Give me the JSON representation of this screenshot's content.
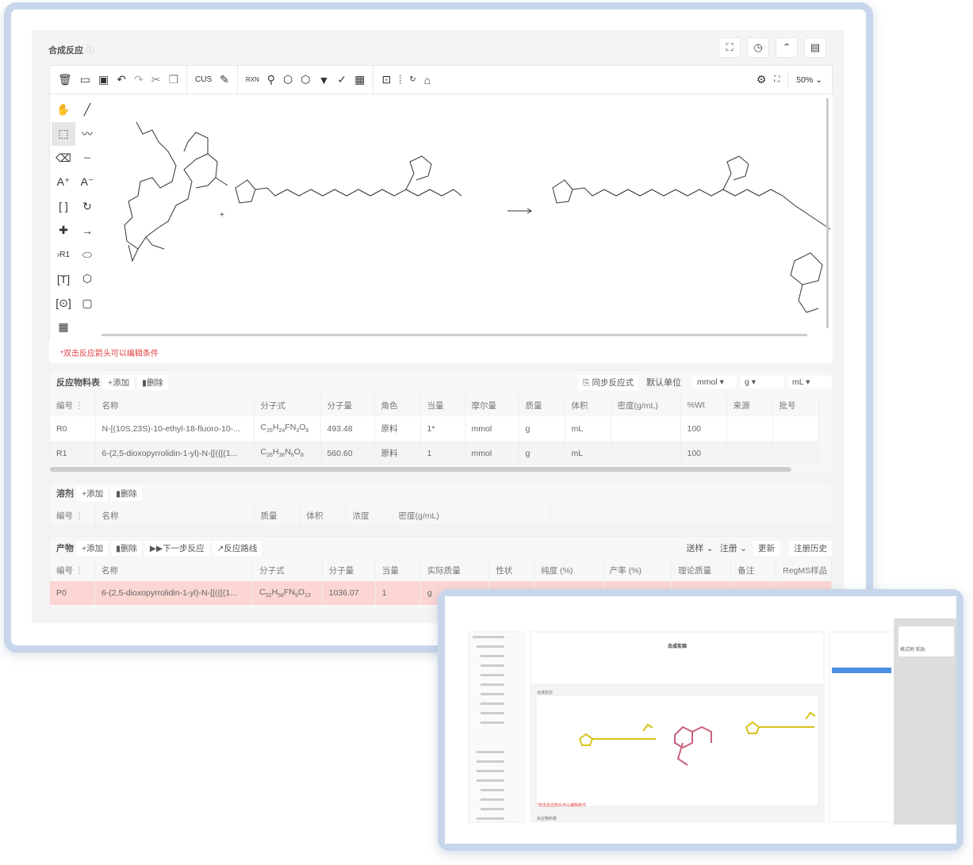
{
  "section": {
    "title": "合成反应",
    "help_icon": "question-circle-icon",
    "header_icons": [
      "fullscreen-icon",
      "history-icon",
      "collapse-icon",
      "notes-icon"
    ]
  },
  "toolbar": {
    "cus": "CUS",
    "zoom": "50%",
    "rxn": "RXN"
  },
  "note": "*双击反应箭头可以编辑条件",
  "reactants": {
    "title": "反应物料表",
    "add": "+添加",
    "delete": "删除",
    "sync": "同步反应式",
    "default_unit": "默认单位",
    "units": [
      "mmol",
      "g",
      "mL"
    ],
    "headers": [
      "编号",
      "名称",
      "分子式",
      "分子量",
      "角色",
      "当量",
      "摩尔量",
      "质量",
      "体积",
      "密度(g/mL)",
      "%Wt",
      "来源",
      "批号"
    ],
    "rows": [
      [
        "R0",
        "N-[(10S,23S)-10-ethyl-18-fluoro-10-...",
        "C26H24FN3O6",
        "493.48",
        "原料",
        "1*",
        "mmol",
        "g",
        "mL",
        "",
        "100",
        "",
        ""
      ],
      [
        "R1",
        "6-(2,5-dioxopyrrolidin-1-yl)-N-[[({[(1...",
        "C26H36N6O8",
        "560.60",
        "原料",
        "1",
        "mmol",
        "g",
        "mL",
        "",
        "100",
        "",
        ""
      ]
    ]
  },
  "solvent": {
    "title": "溶剂",
    "add": "+添加",
    "delete": "删除",
    "headers": [
      "编号",
      "名称",
      "质量",
      "体积",
      "浓度",
      "密度(g/mL)"
    ]
  },
  "products": {
    "title": "产物",
    "add": "+添加",
    "delete": "删除",
    "next": "▶▶下一步反应",
    "route": "反应路线",
    "send": "送样",
    "register": "注册",
    "update": "更新",
    "history": "注册历史",
    "headers": [
      "编号",
      "名称",
      "分子式",
      "分子量",
      "当量",
      "实际质量",
      "性状",
      "纯度 (%)",
      "产率 (%)",
      "理论质量",
      "备注",
      "RegMS样品"
    ],
    "rows": [
      [
        "P0",
        "6-(2,5-dioxopyrrolidin-1-yl)-N-[[({[(1...",
        "C52H58FN9O13",
        "1036.07",
        "1",
        "g",
        "",
        "",
        "",
        "",
        "",
        ""
      ]
    ]
  },
  "inset": {
    "page_title": "合成实验",
    "section": "合成反应",
    "paste_tools": [
      "格式刷",
      "粘贴"
    ],
    "note": "*双击反应箭头可以编辑条件",
    "zoom": "50%",
    "reactants_title": "反应物料表"
  },
  "colors": {
    "accent": "#4a90e2",
    "error": "#e04040",
    "highlight_row": "#fbd6d3",
    "frame": "#c7d6ea"
  }
}
